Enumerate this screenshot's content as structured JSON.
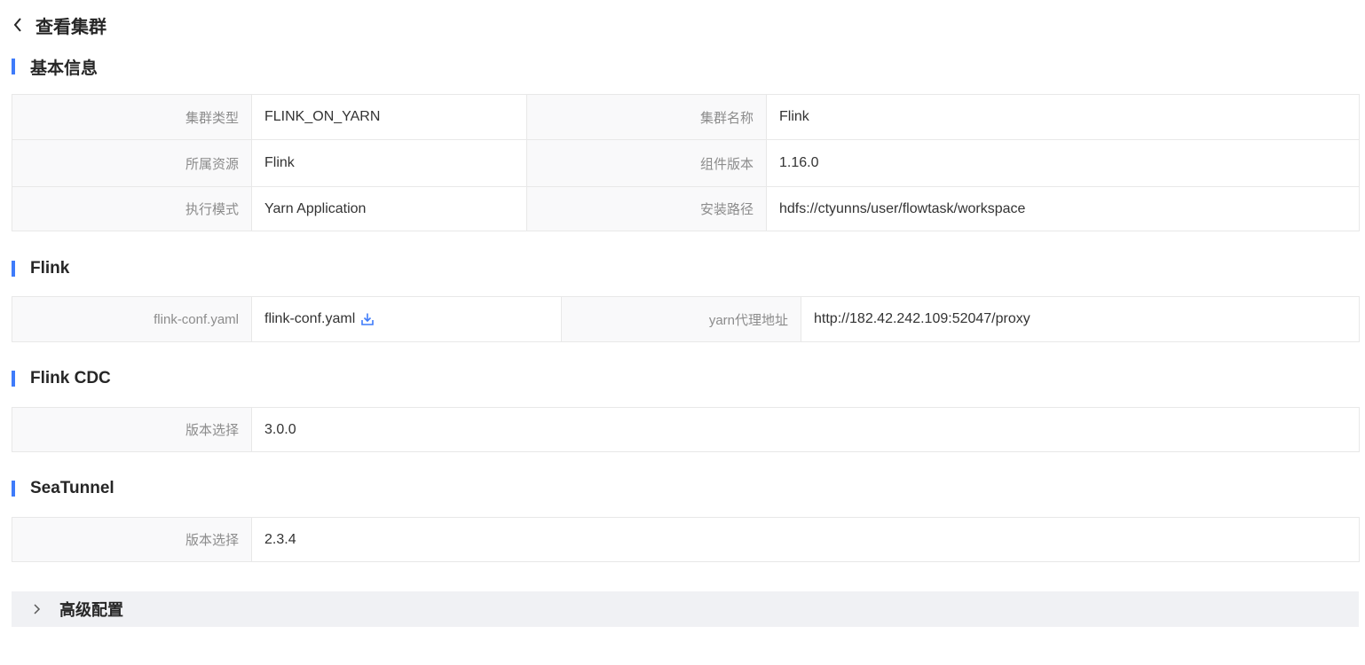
{
  "header": {
    "back_icon": "chevron-left-icon",
    "title": "查看集群"
  },
  "accent_color": "#3e7bfa",
  "sections": {
    "basic": {
      "title": "基本信息",
      "rows": [
        {
          "label1": "集群类型",
          "value1": "FLINK_ON_YARN",
          "label2": "集群名称",
          "value2": "Flink"
        },
        {
          "label1": "所属资源",
          "value1": "Flink",
          "label2": "组件版本",
          "value2": "1.16.0"
        },
        {
          "label1": "执行模式",
          "value1": "Yarn Application",
          "label2": "安装路径",
          "value2": "hdfs://ctyunns/user/flowtask/workspace"
        }
      ]
    },
    "flink": {
      "title": "Flink",
      "conf_label": "flink-conf.yaml",
      "conf_value": "flink-conf.yaml",
      "download_icon": "download-icon",
      "proxy_label": "yarn代理地址",
      "proxy_value": "http://182.42.242.109:52047/proxy"
    },
    "flink_cdc": {
      "title": "Flink CDC",
      "version_label": "版本选择",
      "version_value": "3.0.0"
    },
    "seatunnel": {
      "title": "SeaTunnel",
      "version_label": "版本选择",
      "version_value": "2.3.4"
    }
  },
  "advanced": {
    "icon": "chevron-right-icon",
    "label": "高级配置"
  }
}
